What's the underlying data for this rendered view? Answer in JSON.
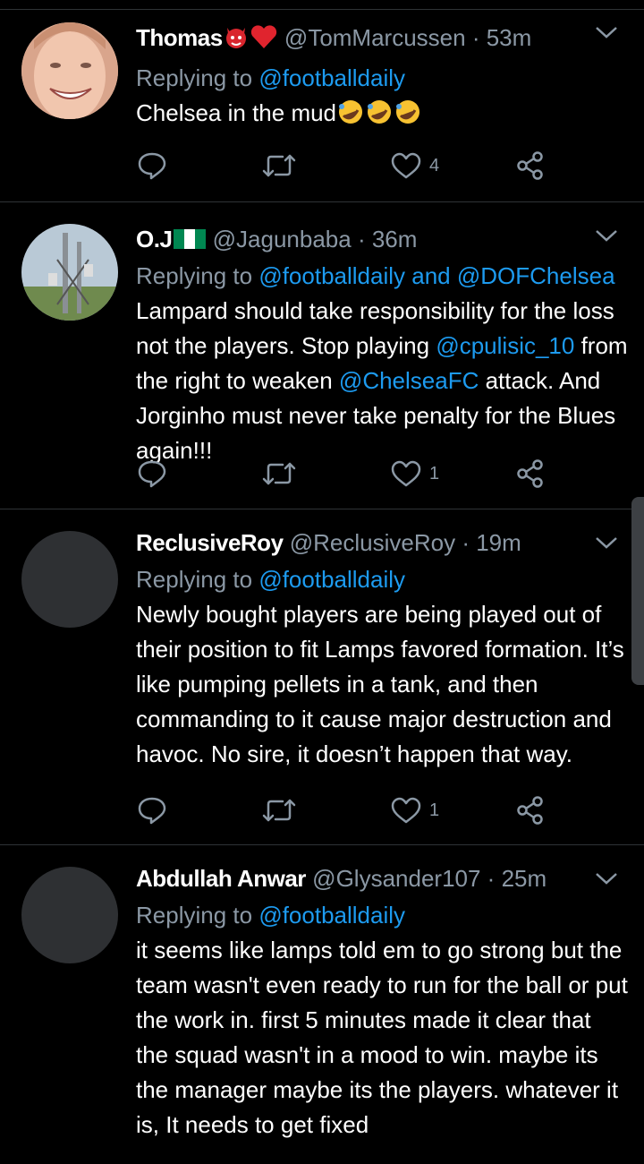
{
  "tweets": [
    {
      "name": "Thomas",
      "handle": "@TomMarcussen",
      "time": "53m",
      "replying_prefix": "Replying to ",
      "replying_to": "@footballdaily",
      "replying_and": "",
      "replying_to_2": "",
      "text": "Chelsea in the mud",
      "likes": "4"
    },
    {
      "name": "O.J",
      "handle": "@Jagunbaba",
      "time": "36m",
      "replying_prefix": "Replying to ",
      "replying_to": "@footballdaily",
      "replying_and": " and ",
      "replying_to_2": "@DOFChelsea",
      "text_parts": [
        "Lampard should take responsibility for the loss not the players. Stop playing ",
        "@cpulisic_10",
        " from the right to weaken ",
        "@ChelseaFC",
        " attack. And Jorginho must never take penalty for the Blues again!!!"
      ],
      "likes": "1"
    },
    {
      "name": "ReclusiveRoy",
      "handle": "@ReclusiveRoy",
      "time": "19m",
      "replying_prefix": "Replying to ",
      "replying_to": "@footballdaily",
      "text": "Newly bought players are being played out of their position to fit Lamps favored formation. It’s like pumping pellets in a tank, and then commanding to it cause major destruction and havoc. No sire, it doesn’t happen that way.",
      "likes": "1"
    },
    {
      "name": "Abdullah Anwar",
      "handle": "@Glysander107",
      "time": "25m",
      "replying_prefix": "Replying to ",
      "replying_to": "@footballdaily",
      "text": "it seems like lamps told em to go strong but the team wasn't even ready to run for the ball or put the work in. first 5 minutes made it clear that the squad wasn't in a mood to win. maybe its the manager maybe its the players. whatever it is, It needs to get fixed"
    }
  ],
  "separator": " · ",
  "icons": [
    "reply-icon",
    "retweet-icon",
    "like-icon",
    "share-icon",
    "chevron-down-icon"
  ],
  "colors": {
    "background": "#000000",
    "link": "#1d9bf0",
    "muted": "#8b98a5",
    "text": "#ffffff",
    "divider": "#2f3336"
  }
}
